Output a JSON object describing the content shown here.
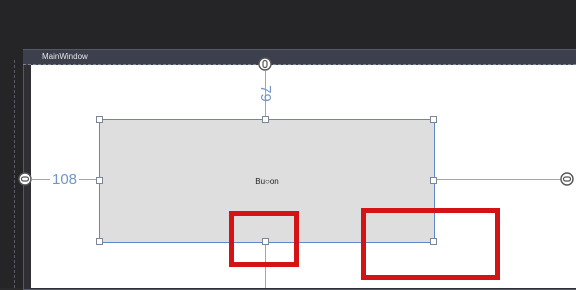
{
  "window": {
    "title": "MainWindow"
  },
  "button": {
    "label": "Bu○on"
  },
  "guides": {
    "top_margin": "79",
    "left_margin": "108"
  },
  "colors": {
    "annotation": "#d41414",
    "selection": "#5f87c9",
    "guide_text": "#6f96c7"
  },
  "icons": {
    "anchor": "chain-link-icon"
  }
}
